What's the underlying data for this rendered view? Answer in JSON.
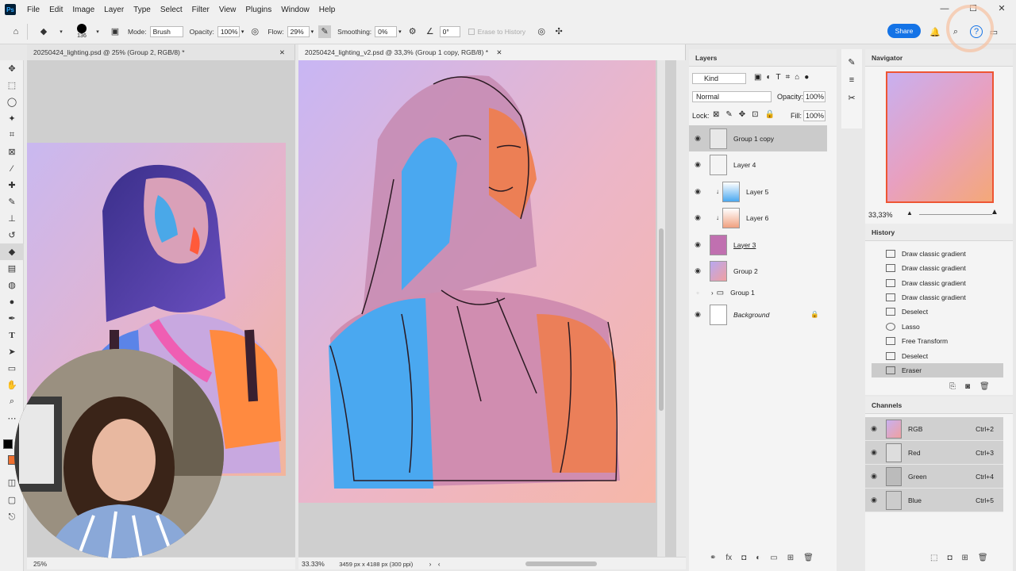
{
  "app": {
    "logo": "Ps"
  },
  "menu": [
    "File",
    "Edit",
    "Image",
    "Layer",
    "Type",
    "Select",
    "Filter",
    "View",
    "Plugins",
    "Window",
    "Help"
  ],
  "window_controls": [
    "—",
    "☐",
    "✕"
  ],
  "options": {
    "brush_size": "136",
    "mode_label": "Mode:",
    "mode_value": "Brush",
    "opacity_label": "Opacity:",
    "opacity_value": "100%",
    "flow_label": "Flow:",
    "flow_value": "29%",
    "smoothing_label": "Smoothing:",
    "smoothing_value": "0%",
    "angle_value": "0°",
    "erase_history": "Erase to History",
    "share_label": "Share"
  },
  "documents": [
    {
      "tab": "20250424_lighting.psd @ 25% (Group 2, RGB/8) *",
      "zoom": "25%"
    },
    {
      "tab": "20250424_lighting_v2.psd @ 33,3% (Group 1 copy, RGB/8) *",
      "zoom": "33.33%",
      "info": "3459 px x 4188 px (300 ppi)"
    }
  ],
  "colors": {
    "foreground": "#000000",
    "background": "#f07030",
    "accent": "#1473e6"
  },
  "layers": {
    "title": "Layers",
    "filter": "Kind",
    "blend_mode": "Normal",
    "opacity_label": "Opacity:",
    "opacity_value": "100%",
    "lock_label": "Lock:",
    "fill_label": "Fill:",
    "fill_value": "100%",
    "items": [
      {
        "name": "Group 1 copy",
        "selected": true,
        "visible": true
      },
      {
        "name": "Layer 4",
        "visible": true
      },
      {
        "name": "Layer 5",
        "visible": true
      },
      {
        "name": "Layer 6",
        "visible": true
      },
      {
        "name": "Layer 3",
        "visible": true
      },
      {
        "name": "Group 2",
        "visible": true
      },
      {
        "name": "Group 1",
        "visible": false
      },
      {
        "name": "Background",
        "visible": true,
        "locked": true
      }
    ]
  },
  "navigator": {
    "title": "Navigator",
    "zoom": "33,33%"
  },
  "history": {
    "title": "History",
    "items": [
      "Draw classic gradient",
      "Draw classic gradient",
      "Draw classic gradient",
      "Draw classic gradient",
      "Deselect",
      "Lasso",
      "Free Transform",
      "Deselect",
      "Eraser"
    ]
  },
  "channels": {
    "title": "Channels",
    "items": [
      {
        "name": "RGB",
        "shortcut": "Ctrl+2"
      },
      {
        "name": "Red",
        "shortcut": "Ctrl+3"
      },
      {
        "name": "Green",
        "shortcut": "Ctrl+4"
      },
      {
        "name": "Blue",
        "shortcut": "Ctrl+5"
      }
    ]
  }
}
